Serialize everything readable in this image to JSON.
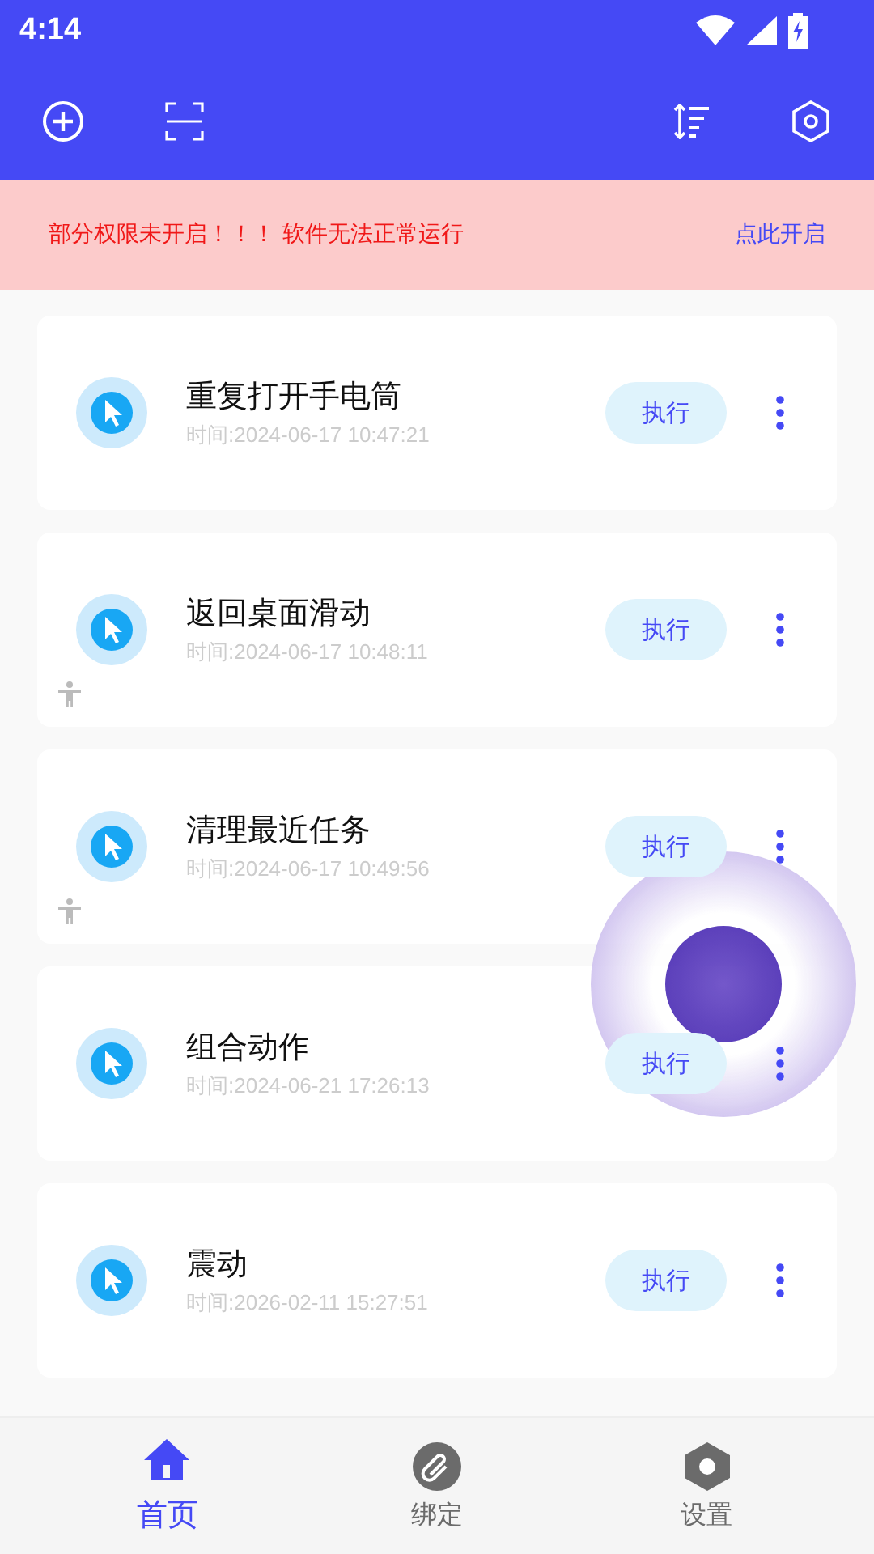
{
  "status_bar": {
    "time": "4:14"
  },
  "banner": {
    "message": "部分权限未开启！！！ 软件无法正常运行",
    "action": "点此开启"
  },
  "tasks": [
    {
      "name": "重复打开手电筒",
      "time": "时间:2024-06-17 10:47:21",
      "button": "执行",
      "accessibility": false
    },
    {
      "name": "返回桌面滑动",
      "time": "时间:2024-06-17 10:48:11",
      "button": "执行",
      "accessibility": true
    },
    {
      "name": "清理最近任务",
      "time": "时间:2024-06-17 10:49:56",
      "button": "执行",
      "accessibility": true
    },
    {
      "name": "组合动作",
      "time": "时间:2024-06-21 17:26:13",
      "button": "执行",
      "accessibility": false
    },
    {
      "name": "震动",
      "time": "时间:2026-02-11 15:27:51",
      "button": "执行",
      "accessibility": false
    }
  ],
  "tabs": [
    {
      "label": "首页",
      "selected": true
    },
    {
      "label": "绑定",
      "selected": false
    },
    {
      "label": "设置",
      "selected": false
    }
  ]
}
